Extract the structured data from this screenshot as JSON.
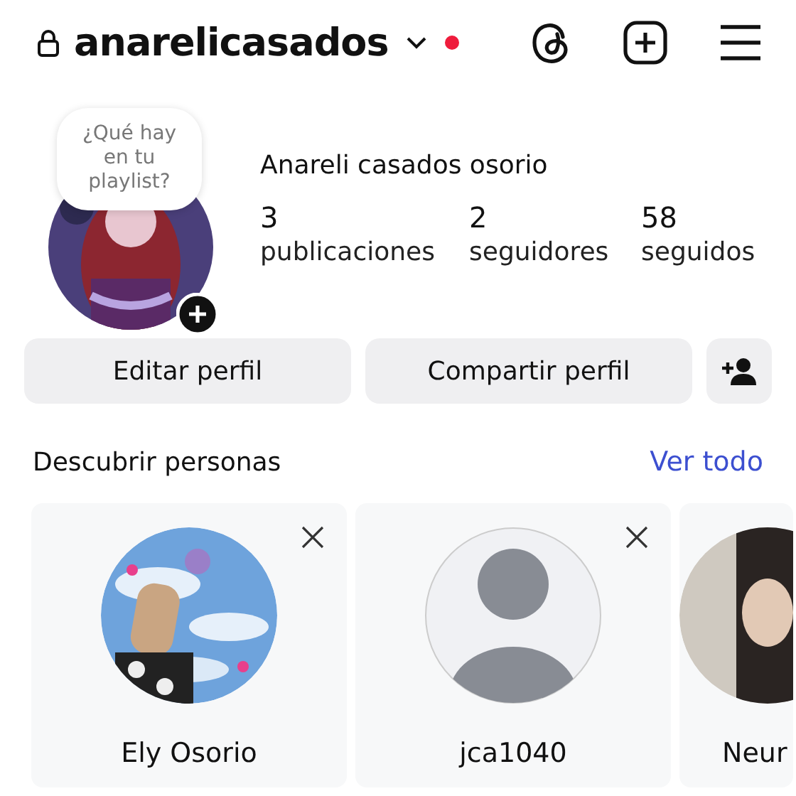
{
  "header": {
    "username": "anarelicasados",
    "has_notification": true
  },
  "profile": {
    "note": "¿Qué hay en tu playlist?",
    "full_name": "Anareli casados osorio",
    "stats": [
      {
        "value": "3",
        "label": "publicaciones"
      },
      {
        "value": "2",
        "label": "seguidores"
      },
      {
        "value": "58",
        "label": "seguidos"
      }
    ]
  },
  "actions": [
    "Editar perfil",
    "Compartir perfil"
  ],
  "discover": {
    "title": "Descubrir personas",
    "link": "Ver todo",
    "people": [
      {
        "name": "Ely Osorio",
        "kind": "picture",
        "dismissible": true
      },
      {
        "name": "jca1040",
        "kind": "default",
        "dismissible": true
      },
      {
        "name": "Neur",
        "kind": "picture",
        "dismissible": false
      }
    ]
  }
}
